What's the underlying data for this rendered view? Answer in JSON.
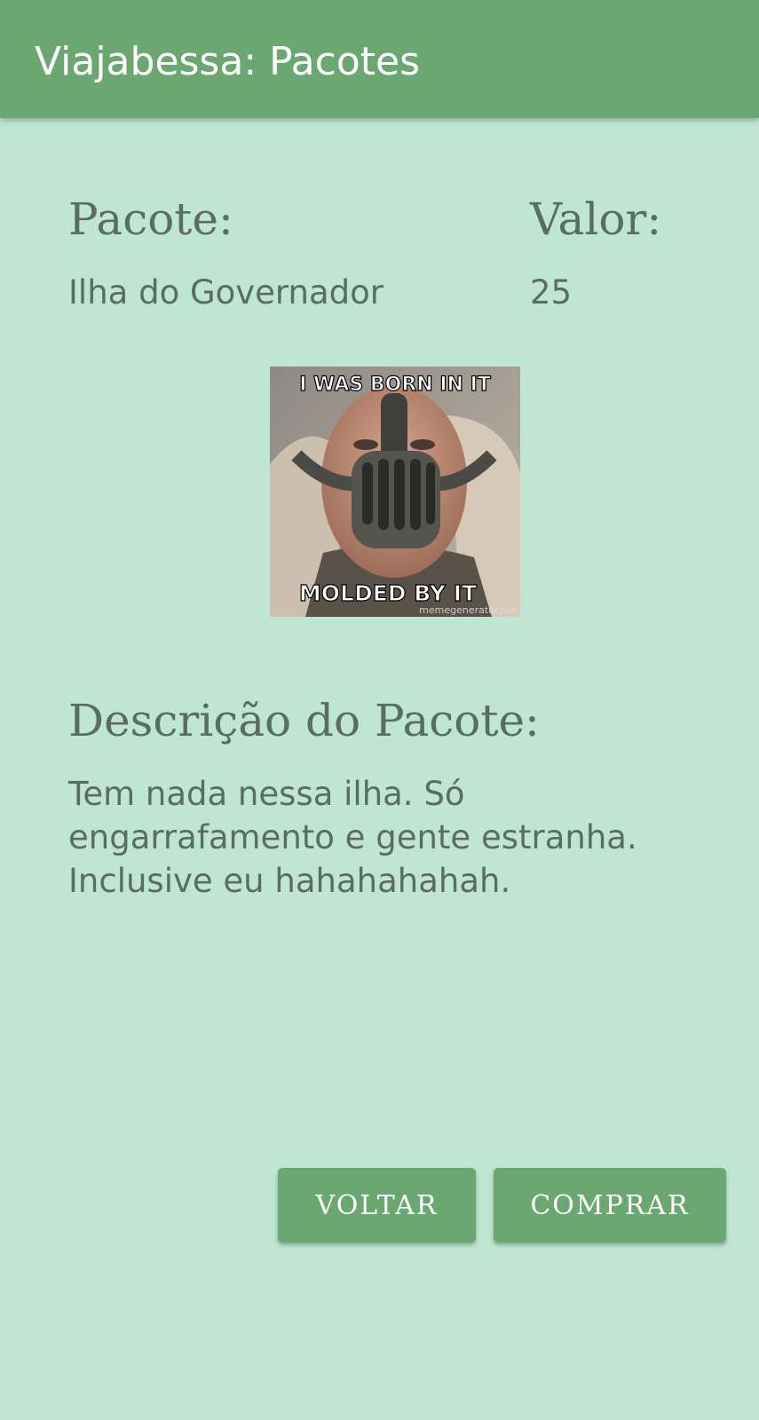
{
  "app_bar": {
    "title": "Viajabessa: Pacotes",
    "color": "#6aa771"
  },
  "package": {
    "name_label": "Pacote:",
    "name": "Ilha do Governador",
    "value_label": "Valor:",
    "value": "25"
  },
  "image": {
    "description": "meme image",
    "top_caption": "I WAS BORN IN IT",
    "bottom_caption": "MOLDED BY IT",
    "watermark": "memegenerator.net"
  },
  "description": {
    "label": "Descrição do Pacote:",
    "text": "Tem nada nessa ilha. Só\nengarrafamento e gente estranha.\nInclusive eu hahahahahah."
  },
  "buttons": {
    "back_label": "VOLTAR",
    "buy_label": "COMPRAR"
  },
  "colors": {
    "background": "#bfe6d3",
    "accent": "#6aa771",
    "text": "#5a6d5f"
  }
}
